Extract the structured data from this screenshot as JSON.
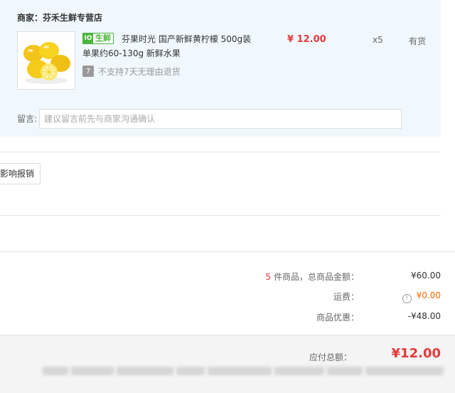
{
  "shop": {
    "name": "商家：芬禾生鲜专营店"
  },
  "product": {
    "tag_logo": "IO",
    "tag_text": "生鲜",
    "title": "芬果时光 国产新鲜黄柠檬 500g装 单果约60-130g 新鲜水果",
    "price": "¥ 12.00",
    "qty": "x5",
    "stock": "有货",
    "return_icon": "7",
    "return_text": "不支持7天无理由退货"
  },
  "message": {
    "label": "留言:",
    "placeholder": "建议留言前先与商家沟通确认"
  },
  "invoice": {
    "button_label": "影响报销"
  },
  "summary": {
    "count": "5",
    "count_suffix": " 件商品，总商品金额：",
    "goods_total": "¥60.00",
    "freight_label": "运费：",
    "freight_icon": "!",
    "freight_value": "¥0.00",
    "discount_label": "商品优惠：",
    "discount_value": "-¥48.00"
  },
  "total": {
    "label": "应付总额：",
    "value": "¥12.00"
  },
  "colors": {
    "accent_red": "#e4393c",
    "fresh_green": "#4bb43c",
    "freight_orange": "#ff6600",
    "panel_bg": "#f0f8fd"
  }
}
